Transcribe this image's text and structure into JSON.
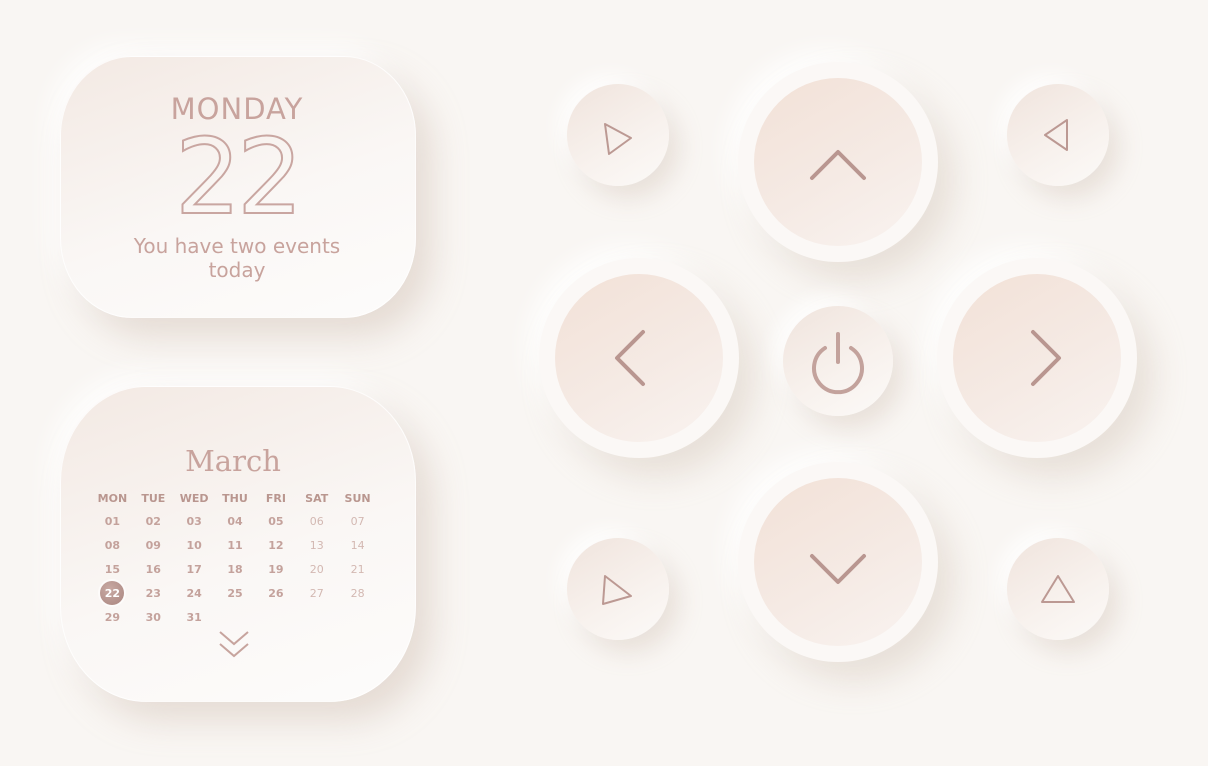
{
  "date_widget": {
    "day_name": "MONDAY",
    "day_number": "22",
    "events_text": "You have two events today"
  },
  "calendar": {
    "month": "March",
    "weekdays": [
      "MON",
      "TUE",
      "WED",
      "THU",
      "FRI",
      "SAT",
      "SUN"
    ],
    "weeks": [
      [
        "01",
        "02",
        "03",
        "04",
        "05",
        "06",
        "07"
      ],
      [
        "08",
        "09",
        "10",
        "11",
        "12",
        "13",
        "14"
      ],
      [
        "15",
        "16",
        "17",
        "18",
        "19",
        "20",
        "21"
      ],
      [
        "22",
        "23",
        "24",
        "25",
        "26",
        "27",
        "28"
      ],
      [
        "29",
        "30",
        "31",
        "",
        "",
        "",
        ""
      ]
    ],
    "selected_day": "22",
    "expand_icon": "double-chevron-down-icon"
  },
  "controls": {
    "icons": {
      "up": "chevron-up-icon",
      "down": "chevron-down-icon",
      "left": "chevron-left-icon",
      "right": "chevron-right-icon",
      "power": "power-icon",
      "play": "play-icon",
      "back": "back-triangle-icon",
      "triangle_right": "triangle-right-icon",
      "triangle_up": "triangle-up-icon"
    }
  },
  "colors": {
    "background": "#f9f6f3",
    "accent": "#c8a39d",
    "selected_day_fill": "#a9857f"
  }
}
